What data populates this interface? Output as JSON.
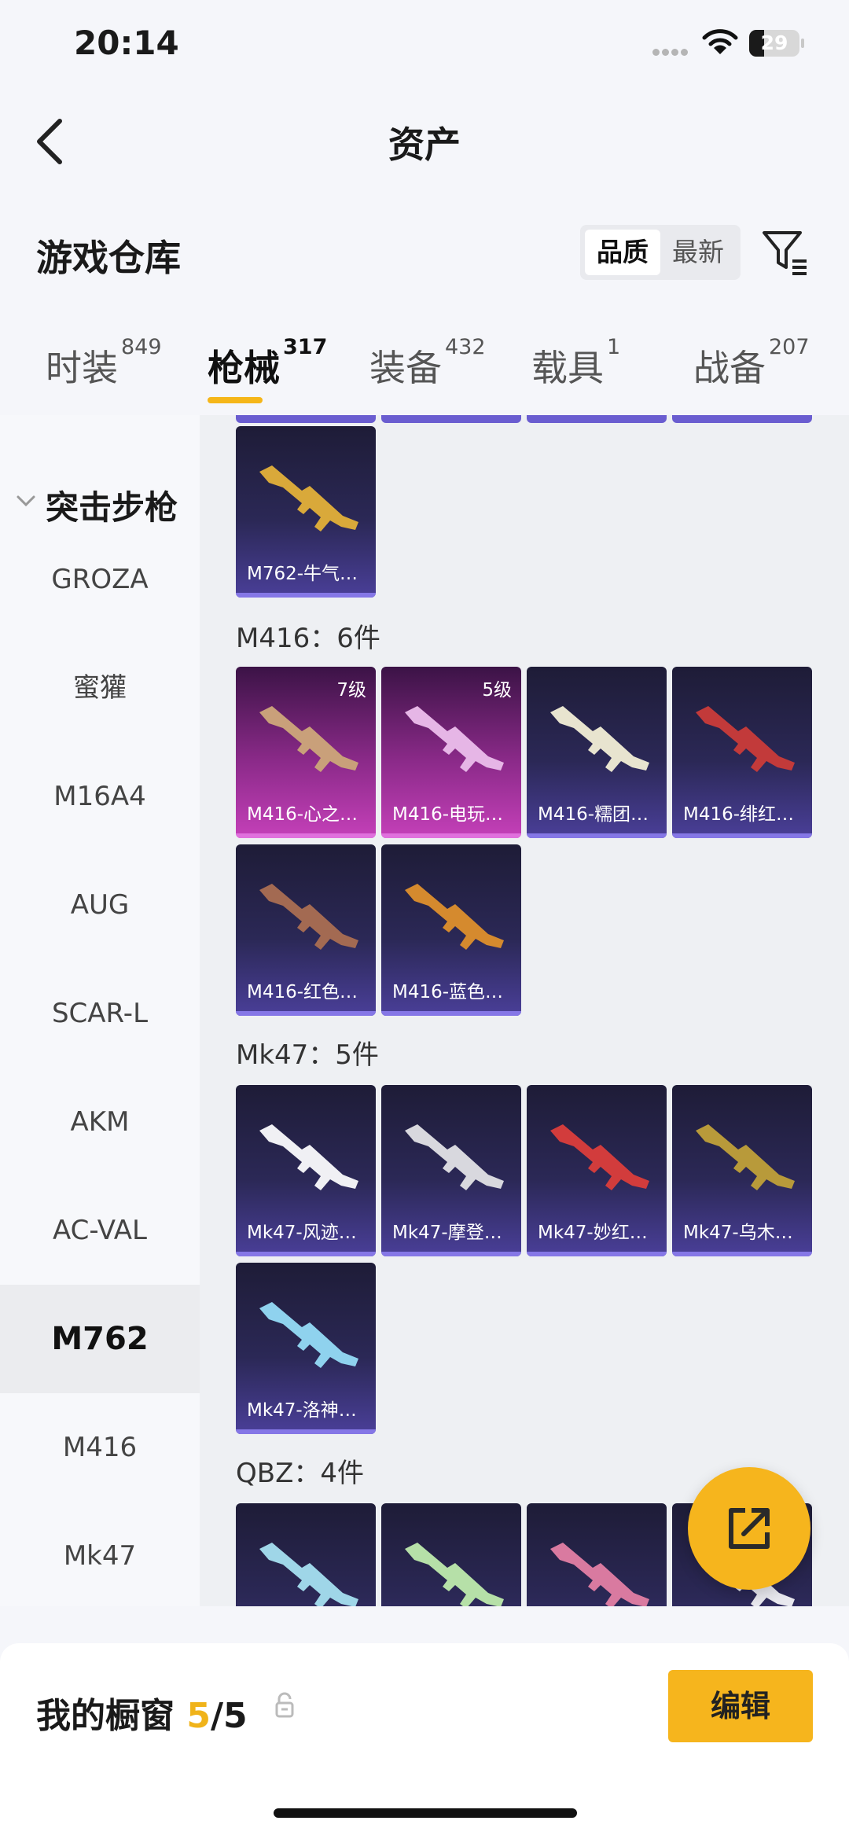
{
  "status_bar": {
    "time": "20:14",
    "battery": "29",
    "battery_level": 0.29
  },
  "header": {
    "title": "资产"
  },
  "section": {
    "title": "游戏仓库",
    "sort_options": [
      "品质",
      "最新"
    ],
    "active_sort": "品质"
  },
  "tabs": [
    {
      "label": "时装",
      "count": "849"
    },
    {
      "label": "枪械",
      "count": "317",
      "active": true
    },
    {
      "label": "装备",
      "count": "432"
    },
    {
      "label": "载具",
      "count": "1"
    },
    {
      "label": "战备",
      "count": "207"
    }
  ],
  "sidebar": {
    "group": "突击步枪",
    "items": [
      "GROZA",
      "蜜獾",
      "M16A4",
      "AUG",
      "SCAR-L",
      "AKM",
      "AC-VAL",
      "M762",
      "M416",
      "Mk47"
    ],
    "active_item": "M762"
  },
  "groups": [
    {
      "label": "",
      "items": [
        {
          "name": "M762-牛气…"
        }
      ]
    },
    {
      "label": "M416：6件",
      "items": [
        {
          "name": "M416-心之…",
          "level": "7级",
          "rarity": "pink"
        },
        {
          "name": "M416-电玩…",
          "level": "5级",
          "rarity": "pink"
        },
        {
          "name": "M416-糯团…"
        },
        {
          "name": "M416-绯红…"
        },
        {
          "name": "M416-红色…"
        },
        {
          "name": "M416-蓝色…"
        }
      ]
    },
    {
      "label": "Mk47：5件",
      "items": [
        {
          "name": "Mk47-风迹…"
        },
        {
          "name": "Mk47-摩登…"
        },
        {
          "name": "Mk47-妙红…"
        },
        {
          "name": "Mk47-乌木…"
        },
        {
          "name": "Mk47-洛神…"
        }
      ]
    },
    {
      "label": "QBZ：4件",
      "items": [
        {
          "name": ""
        },
        {
          "name": ""
        },
        {
          "name": ""
        },
        {
          "name": ""
        }
      ]
    }
  ],
  "bottom_bar": {
    "label": "我的橱窗",
    "count_current": "5",
    "count_total": "/5",
    "edit_label": "编辑"
  },
  "colors": {
    "accent": "#f6b51d",
    "card_purple": "#2b2856",
    "card_pink": "#c540b9"
  }
}
